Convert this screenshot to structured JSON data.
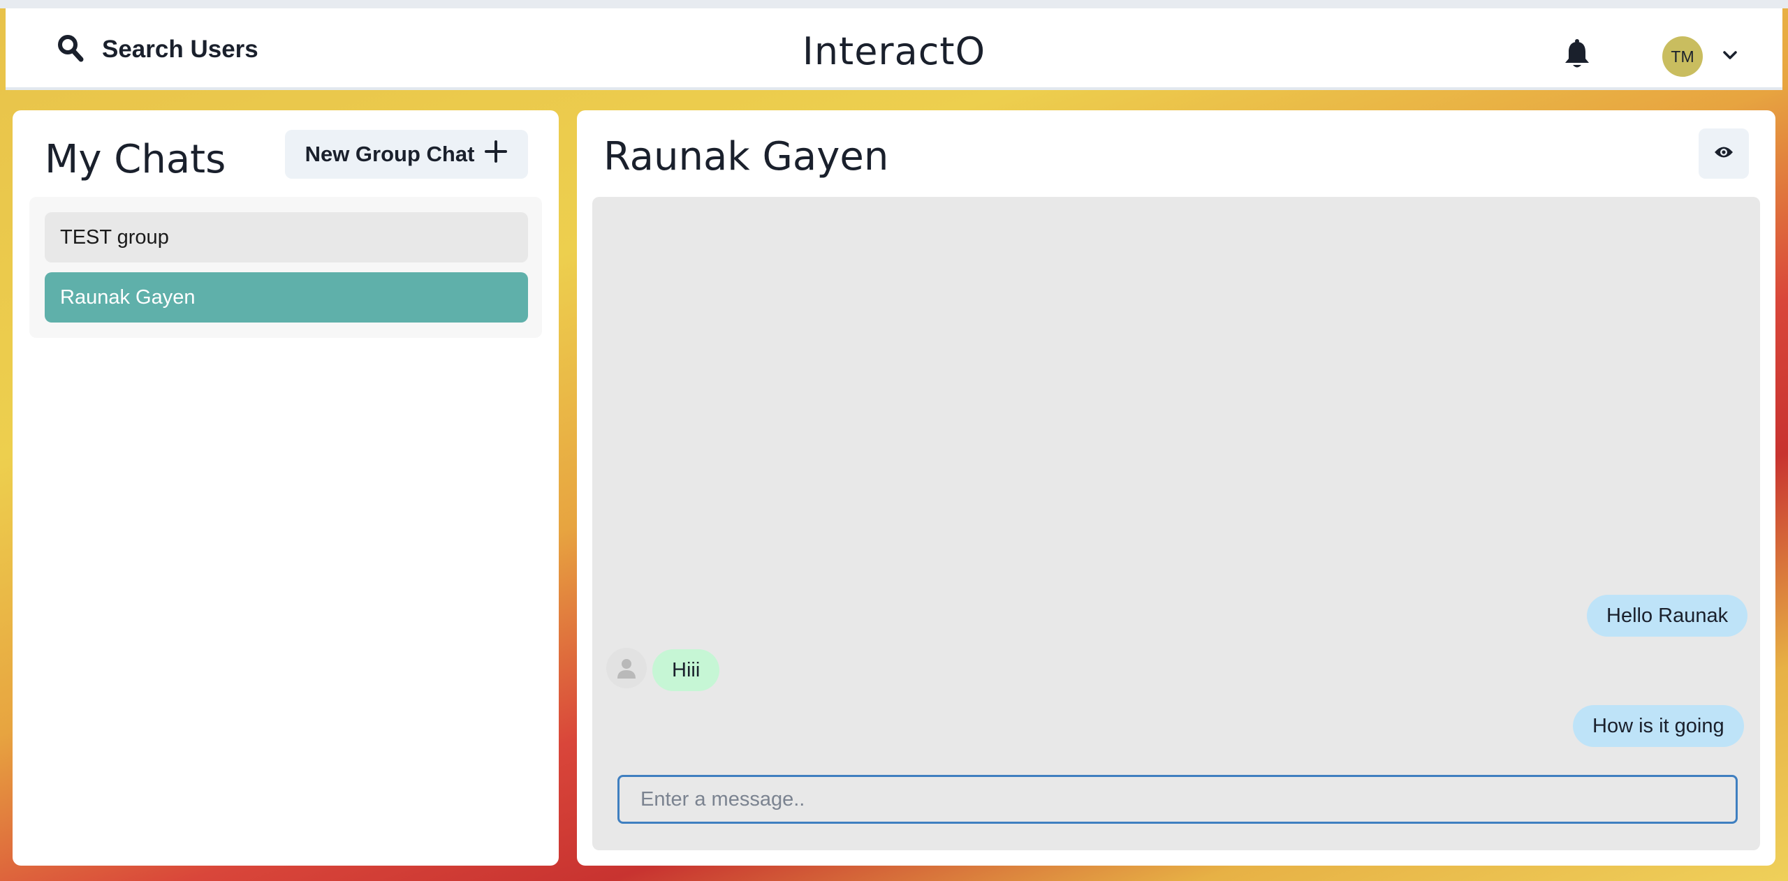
{
  "header": {
    "search_label": "Search Users",
    "brand": "InteractO",
    "avatar_initials": "TM"
  },
  "sidebar": {
    "title": "My Chats",
    "new_group_label": "New Group Chat",
    "chats": [
      {
        "label": "TEST group",
        "selected": false
      },
      {
        "label": "Raunak Gayen",
        "selected": true
      }
    ]
  },
  "chat": {
    "title": "Raunak Gayen",
    "messages": [
      {
        "text": "Hello Raunak",
        "from": "me"
      },
      {
        "text": "Hiii",
        "from": "other"
      },
      {
        "text": "How is it going",
        "from": "me"
      }
    ],
    "input": {
      "value": "",
      "placeholder": "Enter a message.."
    }
  },
  "colors": {
    "selected_chat": "#5fb0aa",
    "sent_bubble": "#bee3f8",
    "received_bubble": "#c6f6d5",
    "avatar": "#c9bd5f"
  },
  "icons": [
    "search-icon",
    "bell-icon",
    "chevron-down-icon",
    "plus-icon",
    "eye-icon",
    "user-icon"
  ]
}
